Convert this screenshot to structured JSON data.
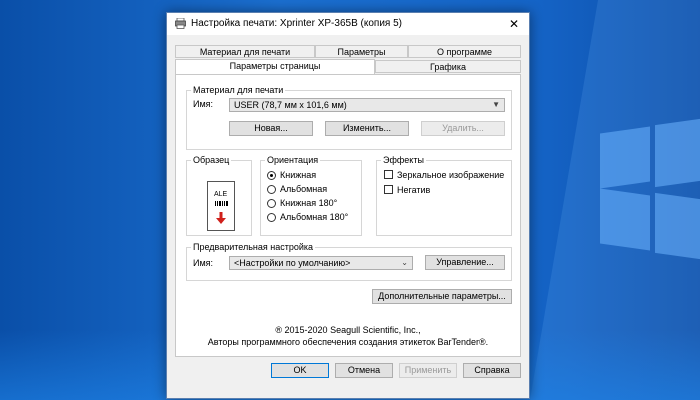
{
  "window": {
    "title": "Настройка печати: Xprinter XP-365B (копия 5)",
    "close_glyph": "✕"
  },
  "tabs": {
    "row1": [
      "Материал для печати",
      "Параметры",
      "О программе"
    ],
    "row2": [
      "Параметры страницы",
      "Графика"
    ],
    "active": "Параметры страницы"
  },
  "material": {
    "group_label": "Материал для печати",
    "name_label": "Имя:",
    "selected": "USER (78,7 мм x 101,6 мм)",
    "new_button": "Новая...",
    "edit_button": "Изменить...",
    "delete_button": "Удалить..."
  },
  "sample": {
    "group_label": "Образец",
    "label_text": "ALE"
  },
  "orientation": {
    "group_label": "Ориентация",
    "options": [
      "Книжная",
      "Альбомная",
      "Книжная 180°",
      "Альбомная 180°"
    ],
    "selected_index": 0
  },
  "effects": {
    "group_label": "Эффекты",
    "options": [
      "Зеркальное изображение",
      "Негатив"
    ]
  },
  "preset": {
    "group_label": "Предварительная настройка",
    "name_label": "Имя:",
    "selected": "<Настройки по умолчанию>",
    "manage_button": "Управление..."
  },
  "advanced_button": "Дополнительные параметры...",
  "copyright": {
    "line1": "® 2015-2020 Seagull Scientific, Inc.,",
    "line2": "Авторы программного обеспечения создания этикеток BarTender®."
  },
  "footer": {
    "ok": "OK",
    "cancel": "Отмена",
    "apply": "Применить",
    "help": "Справка"
  },
  "colors": {
    "desktop": "#1565c8",
    "dialog_bg": "#f0f0f0",
    "default_button_border": "#0078d7",
    "arrow_red": "#d0201b"
  }
}
